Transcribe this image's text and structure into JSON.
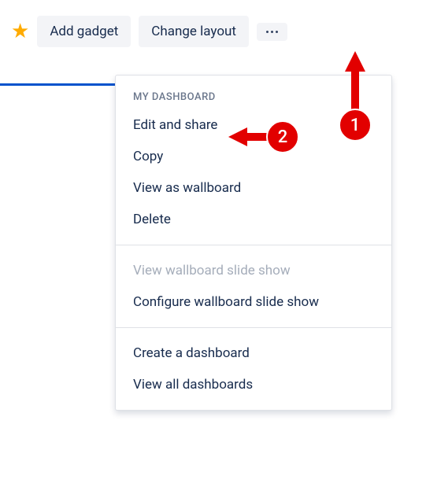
{
  "toolbar": {
    "add_gadget_label": "Add gadget",
    "change_layout_label": "Change layout"
  },
  "dropdown": {
    "section_header": "MY DASHBOARD",
    "section1": {
      "edit_share": "Edit and share",
      "copy": "Copy",
      "view_wallboard": "View as wallboard",
      "delete": "Delete"
    },
    "section2": {
      "view_slideshow": "View wallboard slide show",
      "configure_slideshow": "Configure wallboard slide show"
    },
    "section3": {
      "create_dashboard": "Create a dashboard",
      "view_all": "View all dashboards"
    }
  },
  "annotations": {
    "step1": "1",
    "step2": "2"
  }
}
